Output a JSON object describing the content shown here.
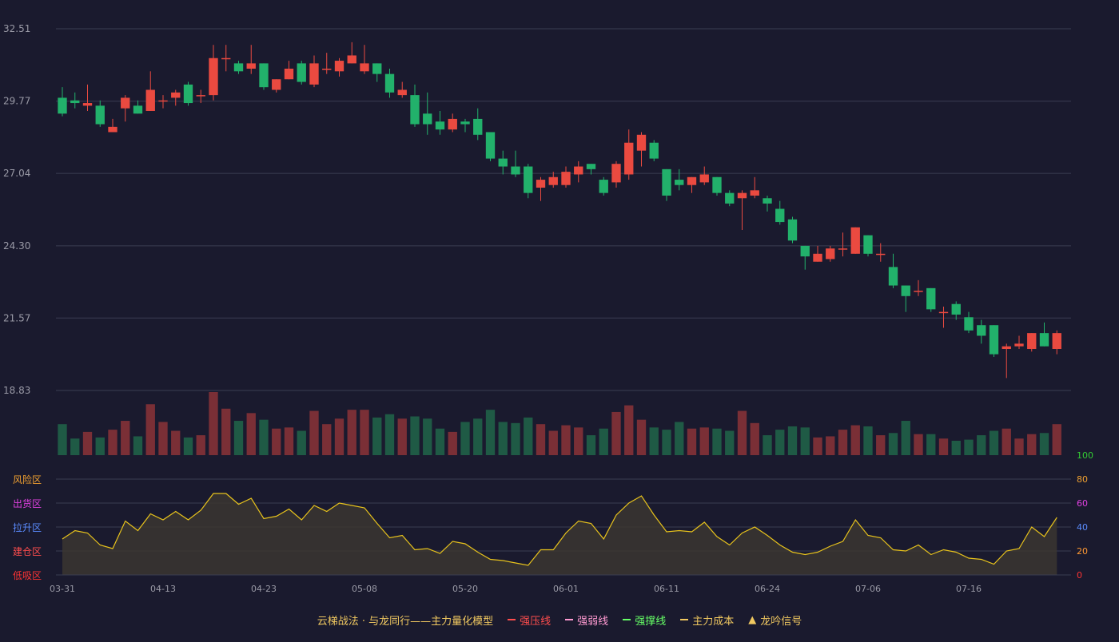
{
  "chart_data": {
    "type": "candlestick",
    "price_axis": {
      "ticks": [
        "32.51",
        "29.77",
        "27.04",
        "24.30",
        "21.57",
        "18.83"
      ],
      "ylim": [
        18.83,
        32.51
      ]
    },
    "date_ticks": [
      {
        "label": "03-31",
        "index": 0
      },
      {
        "label": "04-13",
        "index": 8
      },
      {
        "label": "04-23",
        "index": 16
      },
      {
        "label": "05-08",
        "index": 24
      },
      {
        "label": "05-20",
        "index": 32
      },
      {
        "label": "06-01",
        "index": 40
      },
      {
        "label": "06-11",
        "index": 48
      },
      {
        "label": "06-24",
        "index": 56
      },
      {
        "label": "07-06",
        "index": 64
      },
      {
        "label": "07-16",
        "index": 72
      }
    ],
    "ohlc": [
      [
        29.9,
        29.3,
        30.3,
        29.2
      ],
      [
        29.8,
        29.7,
        30.1,
        29.5
      ],
      [
        29.6,
        29.7,
        30.4,
        29.4
      ],
      [
        29.6,
        28.9,
        29.8,
        28.8
      ],
      [
        28.6,
        28.8,
        29.1,
        28.6
      ],
      [
        29.5,
        29.9,
        30.0,
        29.0
      ],
      [
        29.6,
        29.3,
        29.8,
        29.3
      ],
      [
        29.4,
        30.2,
        30.9,
        29.4
      ],
      [
        29.8,
        29.8,
        30.0,
        29.5
      ],
      [
        29.9,
        30.1,
        30.2,
        29.6
      ],
      [
        30.4,
        29.7,
        30.5,
        29.6
      ],
      [
        30.0,
        30.0,
        30.2,
        29.7
      ],
      [
        30.0,
        31.4,
        31.9,
        29.8
      ],
      [
        31.4,
        31.4,
        31.9,
        30.9
      ],
      [
        31.2,
        30.9,
        31.3,
        30.8
      ],
      [
        31.0,
        31.2,
        31.9,
        30.8
      ],
      [
        31.2,
        30.3,
        31.2,
        30.2
      ],
      [
        30.2,
        30.6,
        30.6,
        30.1
      ],
      [
        30.6,
        31.0,
        31.3,
        30.6
      ],
      [
        31.2,
        30.5,
        31.3,
        30.4
      ],
      [
        30.4,
        31.2,
        31.5,
        30.3
      ],
      [
        31.0,
        31.0,
        31.6,
        30.8
      ],
      [
        30.9,
        31.3,
        31.4,
        30.7
      ],
      [
        31.2,
        31.5,
        32.0,
        31.2
      ],
      [
        30.9,
        31.2,
        31.9,
        30.8
      ],
      [
        31.2,
        30.8,
        31.2,
        30.5
      ],
      [
        30.8,
        30.1,
        31.0,
        29.9
      ],
      [
        30.0,
        30.2,
        30.5,
        29.9
      ],
      [
        30.0,
        28.9,
        30.4,
        28.8
      ],
      [
        29.3,
        28.9,
        30.1,
        28.5
      ],
      [
        29.0,
        28.7,
        29.4,
        28.5
      ],
      [
        28.7,
        29.1,
        29.3,
        28.6
      ],
      [
        29.0,
        28.9,
        29.1,
        28.6
      ],
      [
        29.1,
        28.5,
        29.5,
        28.3
      ],
      [
        28.6,
        27.6,
        28.6,
        27.5
      ],
      [
        27.6,
        27.3,
        27.9,
        27.0
      ],
      [
        27.3,
        27.0,
        27.9,
        26.9
      ],
      [
        27.3,
        26.3,
        27.4,
        26.1
      ],
      [
        26.5,
        26.8,
        26.9,
        26.0
      ],
      [
        26.6,
        26.9,
        27.1,
        26.5
      ],
      [
        26.6,
        27.1,
        27.3,
        26.5
      ],
      [
        27.0,
        27.3,
        27.5,
        26.7
      ],
      [
        27.4,
        27.2,
        27.4,
        27.0
      ],
      [
        26.8,
        26.3,
        26.9,
        26.2
      ],
      [
        26.7,
        27.4,
        27.5,
        26.5
      ],
      [
        27.0,
        28.2,
        28.7,
        26.8
      ],
      [
        27.9,
        28.5,
        28.6,
        27.3
      ],
      [
        28.2,
        27.6,
        28.3,
        27.5
      ],
      [
        27.2,
        26.2,
        27.2,
        26.0
      ],
      [
        26.8,
        26.6,
        27.2,
        26.4
      ],
      [
        26.6,
        26.9,
        26.9,
        26.3
      ],
      [
        26.7,
        27.0,
        27.3,
        26.6
      ],
      [
        26.9,
        26.3,
        26.9,
        26.2
      ],
      [
        26.3,
        25.9,
        26.4,
        25.8
      ],
      [
        26.1,
        26.3,
        26.4,
        24.9
      ],
      [
        26.2,
        26.4,
        26.9,
        26.1
      ],
      [
        26.1,
        25.9,
        26.2,
        25.6
      ],
      [
        25.7,
        25.2,
        26.0,
        25.1
      ],
      [
        25.3,
        24.5,
        25.4,
        24.4
      ],
      [
        24.3,
        23.9,
        24.3,
        23.4
      ],
      [
        23.7,
        24.0,
        24.3,
        23.7
      ],
      [
        23.8,
        24.2,
        24.3,
        23.7
      ],
      [
        24.2,
        24.2,
        24.8,
        23.9
      ],
      [
        24.0,
        25.0,
        25.0,
        24.0
      ],
      [
        24.7,
        24.0,
        24.7,
        23.9
      ],
      [
        24.0,
        24.0,
        24.4,
        23.7
      ],
      [
        23.5,
        22.8,
        24.0,
        22.7
      ],
      [
        22.8,
        22.4,
        22.8,
        21.8
      ],
      [
        22.6,
        22.6,
        23.0,
        22.4
      ],
      [
        22.7,
        21.9,
        22.7,
        21.8
      ],
      [
        21.8,
        21.8,
        22.0,
        21.2
      ],
      [
        22.1,
        21.7,
        22.2,
        21.5
      ],
      [
        21.6,
        21.1,
        21.8,
        21.0
      ],
      [
        21.3,
        20.9,
        21.5,
        20.6
      ],
      [
        21.3,
        20.2,
        21.3,
        20.1
      ],
      [
        20.4,
        20.5,
        20.6,
        19.3
      ],
      [
        20.5,
        20.6,
        20.9,
        20.4
      ],
      [
        20.4,
        21.0,
        21.0,
        20.3
      ],
      [
        21.0,
        20.5,
        21.4,
        20.5
      ],
      [
        20.4,
        21.0,
        21.1,
        20.2
      ]
    ],
    "volume": [
      28,
      15,
      21,
      16,
      23,
      31,
      17,
      46,
      30,
      22,
      16,
      18,
      57,
      42,
      31,
      38,
      32,
      24,
      25,
      22,
      40,
      28,
      33,
      41,
      41,
      34,
      37,
      33,
      35,
      33,
      24,
      21,
      30,
      33,
      41,
      30,
      29,
      34,
      28,
      22,
      27,
      25,
      18,
      24,
      39,
      45,
      32,
      25,
      23,
      30,
      24,
      25,
      24,
      22,
      40,
      29,
      18,
      23,
      26,
      25,
      16,
      17,
      23,
      27,
      26,
      18,
      20,
      31,
      19,
      19,
      15,
      13,
      14,
      18,
      22,
      24,
      15,
      19,
      20,
      28
    ],
    "indicator": {
      "series_name": "主力成本",
      "axis_ticks": [
        "100",
        "80",
        "60",
        "40",
        "20",
        "0"
      ],
      "zones": [
        "风险区",
        "出货区",
        "拉升区",
        "建仓区",
        "低吸区"
      ],
      "ylim": [
        0,
        100
      ],
      "values": [
        30,
        37,
        35,
        25,
        22,
        45,
        37,
        51,
        46,
        53,
        46,
        54,
        68,
        68,
        59,
        64,
        47,
        49,
        55,
        46,
        58,
        53,
        60,
        58,
        56,
        43,
        31,
        33,
        21,
        22,
        18,
        28,
        26,
        19,
        13,
        12,
        10,
        8,
        21,
        21,
        35,
        45,
        43,
        30,
        50,
        60,
        66,
        50,
        36,
        37,
        36,
        44,
        32,
        25,
        35,
        40,
        33,
        25,
        19,
        17,
        19,
        24,
        28,
        46,
        33,
        31,
        21,
        20,
        25,
        17,
        21,
        19,
        14,
        13,
        9,
        20,
        22,
        40,
        32,
        48
      ]
    },
    "legend": [
      {
        "label": "云梯战法 · 与龙同行——主力量化模型",
        "icon": "none",
        "color": "#f0c860"
      },
      {
        "label": "强压线",
        "icon": "line-solid",
        "color": "#ff4d4d"
      },
      {
        "label": "强弱线",
        "icon": "line-dashed",
        "color": "#ff9ad1"
      },
      {
        "label": "强撑线",
        "icon": "line-solid",
        "color": "#66ff66"
      },
      {
        "label": "主力成本",
        "icon": "line-dashed",
        "color": "#f0c860"
      },
      {
        "label": "龙吟信号",
        "icon": "triangle",
        "color": "#f0c860"
      }
    ],
    "colors": {
      "up": "#ea4a40",
      "down": "#22b16b",
      "vol_up": "#7a2f36",
      "vol_down": "#1f5a45",
      "grid": "#3a3d52",
      "tick_text": "#9a9aa6",
      "indicator_line": "#e8c31c",
      "indicator_fill": "#3b3630",
      "zone_colors": [
        "#f0a030",
        "#e040e0",
        "#5b8cff",
        "#ff4d4d",
        "#ff3333"
      ],
      "axis_tick_colors": [
        "#33cc33",
        "#f0a030",
        "#e040e0",
        "#5b8cff",
        "#ff9933",
        "#ff3333"
      ]
    }
  }
}
